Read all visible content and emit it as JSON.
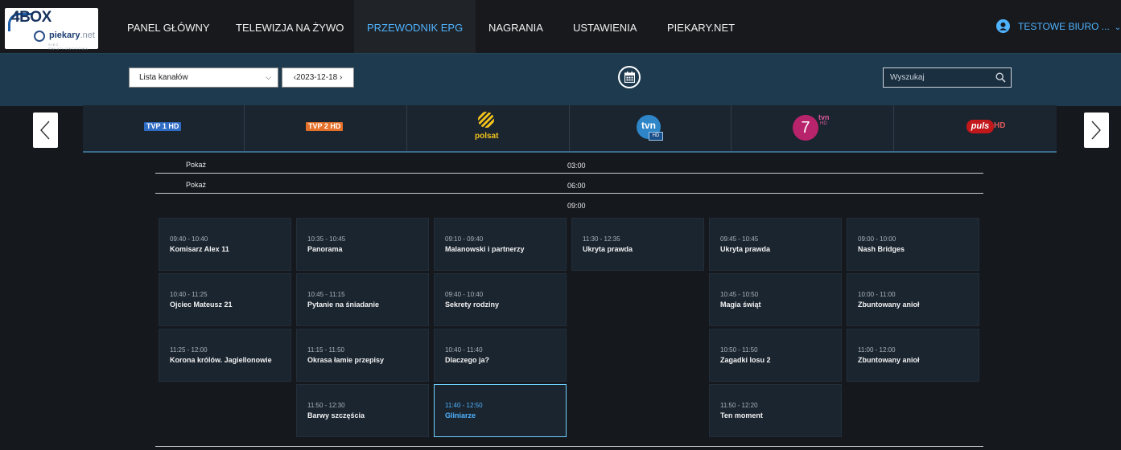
{
  "logo": {
    "brand": "4BOX",
    "sub": "piekary",
    "sub2": ".net",
    "tagline": "SIEĆ ŚWIATŁOWODOWA"
  },
  "nav": {
    "items": [
      {
        "label": "PANEL GŁÓWNY"
      },
      {
        "label": "TELEWIZJA NA ŻYWO"
      },
      {
        "label": "PRZEWODNIK EPG"
      },
      {
        "label": "NAGRANIA"
      },
      {
        "label": "USTAWIENIA"
      },
      {
        "label": "PIEKARY.NET"
      }
    ],
    "active_index": 2,
    "user_label": "TESTOWE BIURO ..."
  },
  "toolbar": {
    "channel_list_value": "Lista kanałów",
    "date_label": "‹2023-12-18 ›",
    "search_placeholder": "Wyszukaj"
  },
  "channels": [
    {
      "name": "TVP 1 HD",
      "icon": "tvp1-logo"
    },
    {
      "name": "TVP 2 HD",
      "icon": "tvp2-logo"
    },
    {
      "name": "polsat",
      "icon": "polsat-logo"
    },
    {
      "name": "tvn HD",
      "icon": "tvn-logo"
    },
    {
      "name": "TVN 7 HD",
      "icon": "tvn7-logo"
    },
    {
      "name": "puls HD",
      "icon": "puls-logo"
    }
  ],
  "time_rows": [
    {
      "show": "Pokaż",
      "time": "03:00"
    },
    {
      "show": "Pokaż",
      "time": "06:00"
    },
    {
      "show": "",
      "time": "09:00"
    }
  ],
  "programs": [
    [
      {
        "time": "09:40 - 10:40",
        "title": "Komisarz Alex 11"
      },
      {
        "time": "10:40 - 11:25",
        "title": "Ojciec Mateusz 21"
      },
      {
        "time": "11:25 - 12:00",
        "title": "Korona królów. Jagiellonowie"
      }
    ],
    [
      {
        "time": "10:35 - 10:45",
        "title": "Panorama"
      },
      {
        "time": "10:45 - 11:15",
        "title": "Pytanie na śniadanie"
      },
      {
        "time": "11:15 - 11:50",
        "title": "Okrasa łamie przepisy"
      },
      {
        "time": "11:50 - 12:30",
        "title": "Barwy szczęścia"
      }
    ],
    [
      {
        "time": "09:10 - 09:40",
        "title": "Malanowski i partnerzy"
      },
      {
        "time": "09:40 - 10:40",
        "title": "Sekrety rodziny"
      },
      {
        "time": "10:40 - 11:40",
        "title": "Dlaczego ja?"
      },
      {
        "time": "11:40 - 12:50",
        "title": "Gliniarze",
        "selected": true
      }
    ],
    [
      {
        "time": "11:30 - 12:35",
        "title": "Ukryta prawda"
      }
    ],
    [
      {
        "time": "09:45 - 10:45",
        "title": "Ukryta prawda"
      },
      {
        "time": "10:45 - 10:50",
        "title": "Magia świąt"
      },
      {
        "time": "10:50 - 11:50",
        "title": "Zagadki losu 2"
      },
      {
        "time": "11:50 - 12:20",
        "title": "Ten moment"
      }
    ],
    [
      {
        "time": "09:00 - 10:00",
        "title": "Nash Bridges"
      },
      {
        "time": "10:00 - 11:00",
        "title": "Zbuntowany anioł"
      },
      {
        "time": "11:00 - 12:00",
        "title": "Zbuntowany anioł"
      }
    ]
  ],
  "colors": {
    "accent": "#4fb3ff",
    "toolbar": "#1e3a4f",
    "background": "#15181d",
    "card": "#1b2530"
  }
}
